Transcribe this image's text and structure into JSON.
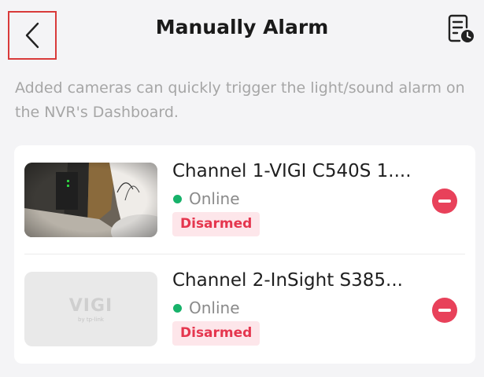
{
  "header": {
    "title": "Manually Alarm",
    "back_icon": "chevron-left-icon",
    "log_icon": "document-clock-icon"
  },
  "description": "Added cameras can quickly trigger the light/sound alarm on the NVR's Dashboard.",
  "cameras": [
    {
      "name": "Channel 1-VIGI C540S 1....",
      "status": "Online",
      "badge": "Disarmed",
      "thumbnail": "camera-live-snapshot"
    },
    {
      "name": "Channel 2-InSight S385...",
      "status": "Online",
      "badge": "Disarmed",
      "thumbnail": "vigi-placeholder",
      "placeholder_logo": "VIGI",
      "placeholder_sub": "by tp-link"
    }
  ],
  "colors": {
    "online": "#17b26a",
    "danger": "#e8415a",
    "badge_bg": "#fde6ea",
    "badge_text": "#e5364e"
  }
}
